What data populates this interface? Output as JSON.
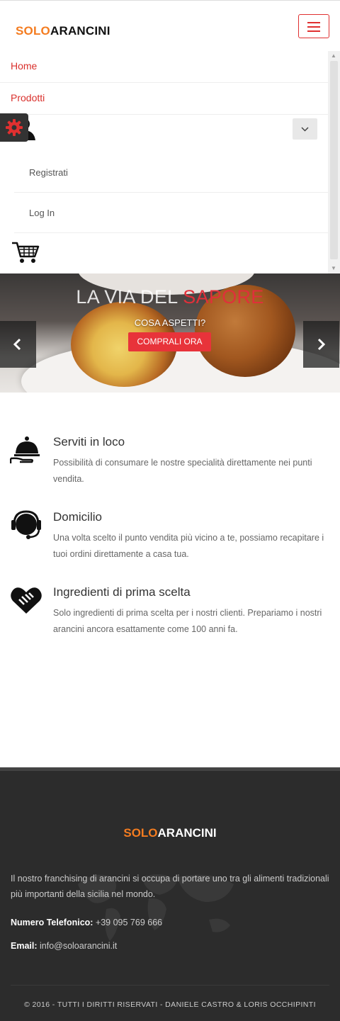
{
  "header": {
    "logo_solo": "SOLO",
    "logo_arancini": "ARANCINI",
    "menu_icon": "hamburger-icon"
  },
  "nav": {
    "home": "Home",
    "products": "Prodotti",
    "account_icon": "user-icon",
    "dropdown_icon": "chevron-down-icon",
    "register": "Registrati",
    "login": "Log In",
    "cart_icon": "cart-icon"
  },
  "settings": {
    "icon": "gear-icon",
    "color": "#e03030"
  },
  "hero": {
    "title_part1": "LA VIA DEL ",
    "title_part2": "SAPORE",
    "subtitle": "COSA ASPETTI?",
    "cta": "COMPRALI ORA",
    "prev_icon": "chevron-left-icon",
    "next_icon": "chevron-right-icon"
  },
  "features": [
    {
      "icon": "cloche-icon",
      "title": "Serviti in loco",
      "description": "Possibilità di consumare le nostre specialità direttamente nei punti vendita."
    },
    {
      "icon": "headset-icon",
      "title": "Domicilio",
      "description": "Una volta scelto il punto vendita più vicino a te, possiamo recapitare i tuoi ordini direttamente a casa tua."
    },
    {
      "icon": "handshake-heart-icon",
      "title": "Ingredienti di prima scelta",
      "description": "Solo ingredienti di prima scelta per i nostri clienti. Prepariamo i nostri arancini ancora esattamente come 100 anni fa."
    }
  ],
  "footer": {
    "logo_solo": "SOLO",
    "logo_arancini": "ARANCINI",
    "description": "Il nostro franchising di arancini si occupa di portare uno tra gli alimenti tradizionali più importanti della sicilia nel mondo.",
    "phone_label": "Numero Telefonico:",
    "phone_value": " +39 095 769 666",
    "email_label": "Email:",
    "email_value": " info@soloarancini.it",
    "copyright": "© 2016 - TUTTI I DIRITTI RISERVATI - DANIELE CASTRO & LORIS OCCHIPINTI"
  },
  "colors": {
    "brand_orange": "#f47c20",
    "accent_red": "#e0303a",
    "footer_bg": "#2c2c2c"
  }
}
